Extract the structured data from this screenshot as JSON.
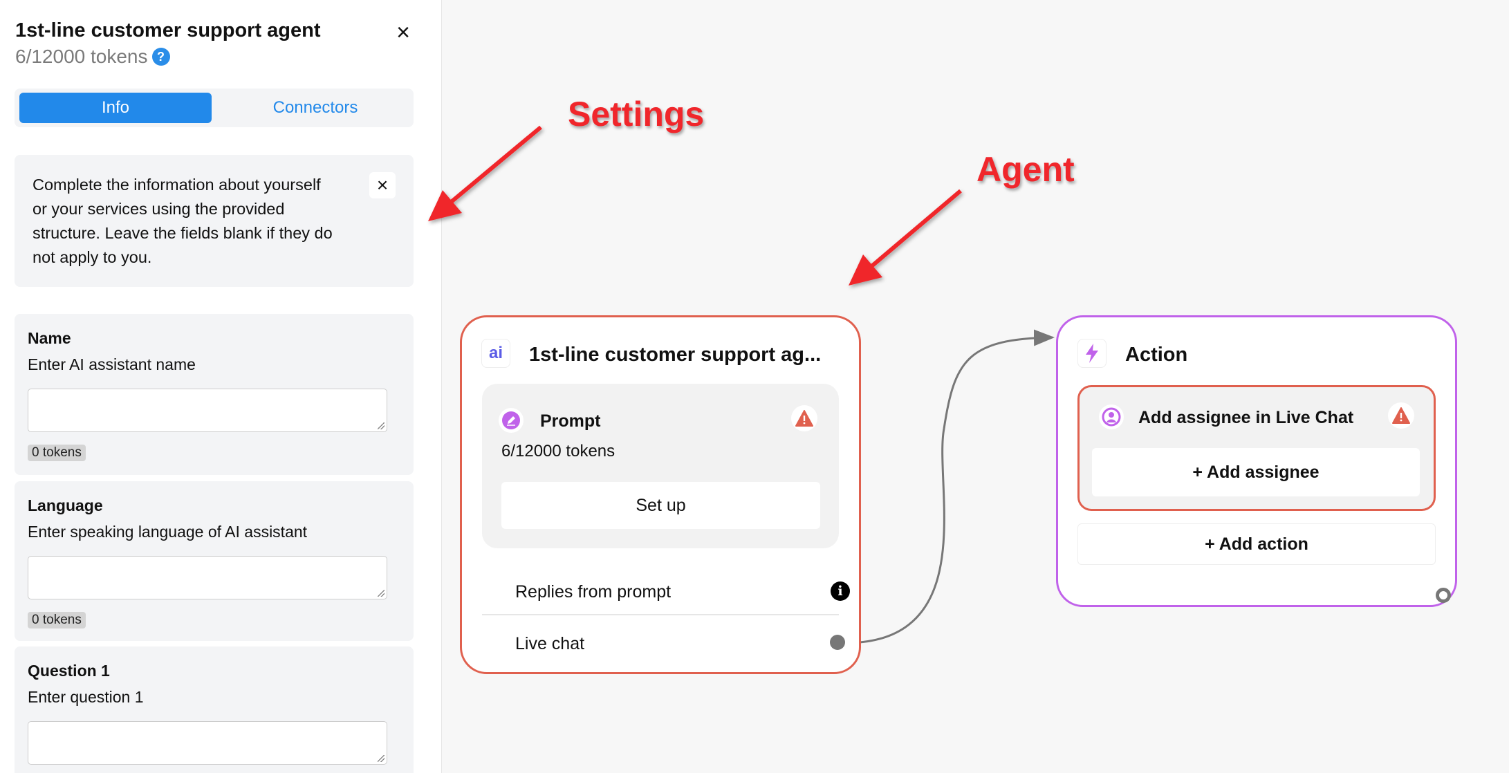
{
  "sidebar": {
    "title": "1st-line customer support agent",
    "tokens": "6/12000 tokens",
    "help_icon": "?",
    "close_icon": "×",
    "tabs": [
      {
        "label": "Info",
        "active": true
      },
      {
        "label": "Connectors",
        "active": false
      }
    ],
    "info_text": "Complete the information about yourself or your services using the provided structure. Leave the fields blank if they do not apply to you.",
    "info_close_icon": "×",
    "fields": [
      {
        "label": "Name",
        "description": "Enter AI assistant name",
        "value": "",
        "tokens": "0 tokens"
      },
      {
        "label": "Language",
        "description": "Enter speaking language of AI assistant",
        "value": "",
        "tokens": "0 tokens"
      },
      {
        "label": "Question 1",
        "description": "Enter question 1",
        "value": ""
      }
    ]
  },
  "annotations": {
    "settings": "Settings",
    "agent": "Agent",
    "color": "#f0262b"
  },
  "agent_node": {
    "title": "1st-line customer support ag...",
    "icon_text": "ai",
    "prompt": {
      "label": "Prompt",
      "tokens": "6/12000 tokens",
      "setup_label": "Set up"
    },
    "outputs": [
      {
        "label": "Replies from prompt",
        "icon": "info-icon"
      },
      {
        "label": "Live chat",
        "icon": "connector-dot"
      }
    ],
    "border_color": "#e0604e"
  },
  "action_node": {
    "title": "Action",
    "item": {
      "label": "Add assignee in Live Chat",
      "button": "+ Add assignee"
    },
    "add_action": "+ Add action",
    "border_color": "#c062ea"
  },
  "colors": {
    "accent": "#2289ea",
    "warning": "#e0604e",
    "purple": "#c062ea"
  }
}
